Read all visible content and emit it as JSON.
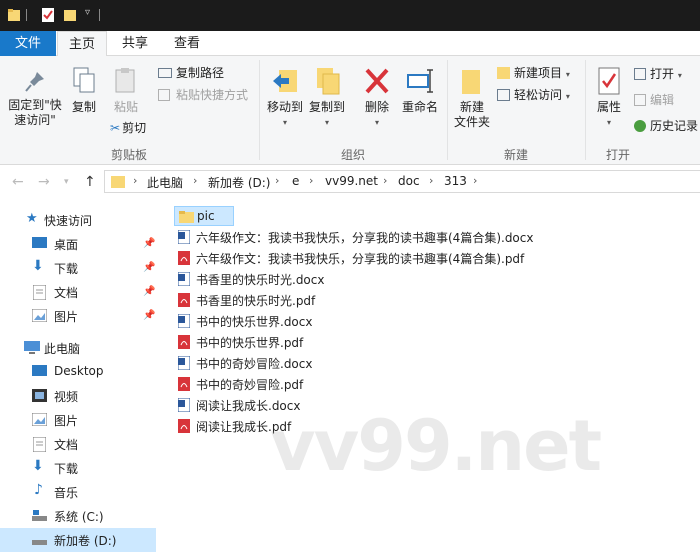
{
  "tabs": {
    "file": "文件",
    "home": "主页",
    "share": "共享",
    "view": "查看"
  },
  "ribbon": {
    "clipboard": {
      "pin": "固定到\"快速访问\"",
      "pin_line1": "固定到\"快",
      "pin_line2": "速访问\"",
      "copy": "复制",
      "paste": "粘贴",
      "copy_path": "复制路径",
      "paste_shortcut": "粘贴快捷方式",
      "cut": "剪切",
      "group": "剪贴板"
    },
    "organize": {
      "move_to": "移动到",
      "copy_to": "复制到",
      "delete": "删除",
      "rename": "重命名",
      "group": "组织"
    },
    "new": {
      "new_folder_line1": "新建",
      "new_folder_line2": "文件夹",
      "new_item": "新建项目",
      "easy_access": "轻松访问",
      "group": "新建"
    },
    "open": {
      "properties": "属性",
      "open": "打开",
      "edit": "编辑",
      "history": "历史记录",
      "group": "打开"
    }
  },
  "address": {
    "crumbs": [
      "此电脑",
      "新加卷 (D:)",
      "e",
      "vv99.net",
      "doc",
      "313"
    ]
  },
  "nav": {
    "quick_access": "快速访问",
    "quick_items": [
      "桌面",
      "下载",
      "文档",
      "图片"
    ],
    "this_pc": "此电脑",
    "pc_items": [
      "Desktop",
      "视频",
      "图片",
      "文档",
      "下载",
      "音乐",
      "系统 (C:)",
      "新加卷 (D:)"
    ]
  },
  "files": [
    {
      "name": "pic",
      "type": "folder"
    },
    {
      "name": "六年级作文：我读书我快乐，分享我的读书趣事(4篇合集).docx",
      "type": "docx"
    },
    {
      "name": "六年级作文：我读书我快乐，分享我的读书趣事(4篇合集).pdf",
      "type": "pdf"
    },
    {
      "name": "书香里的快乐时光.docx",
      "type": "docx"
    },
    {
      "name": "书香里的快乐时光.pdf",
      "type": "pdf"
    },
    {
      "name": "书中的快乐世界.docx",
      "type": "docx"
    },
    {
      "name": "书中的快乐世界.pdf",
      "type": "pdf"
    },
    {
      "name": "书中的奇妙冒险.docx",
      "type": "docx"
    },
    {
      "name": "书中的奇妙冒险.pdf",
      "type": "pdf"
    },
    {
      "name": "阅读让我成长.docx",
      "type": "docx"
    },
    {
      "name": "阅读让我成长.pdf",
      "type": "pdf"
    }
  ],
  "watermark": "vv99.net",
  "colors": {
    "accent": "#1979ca",
    "selection": "#cce8ff",
    "folder": "#f8d775",
    "pdf": "#d8343a",
    "word": "#2b579a"
  }
}
